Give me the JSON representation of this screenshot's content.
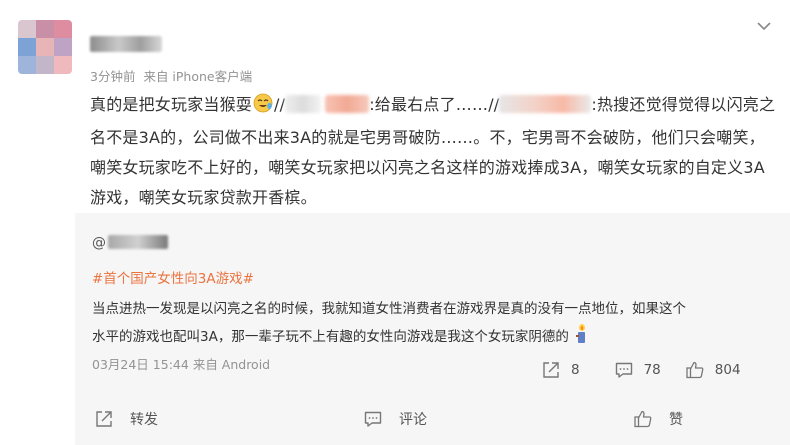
{
  "post": {
    "meta_time": "3分钟前",
    "meta_source": "来自 iPhone客户端",
    "text_a": "真的是把女玩家当猴耍",
    "text_b": "//",
    "text_c": ":给最右点了……//",
    "text_d": ":热搜还觉得觉得以闪亮之名不是3A的，公司做不出来3A的就是宅男哥破防……。不，宅男哥不会破防，他们只会嘲笑，嘲笑女玩家吃不上好的，嘲笑女玩家把以闪亮之名这样的游戏捧成3A，嘲笑女玩家的自定义3A游戏，嘲笑女玩家贷款开香槟。"
  },
  "repost": {
    "nick_prefix": "@",
    "tag": "#首个国产女性向3A游戏#",
    "text": "当点进热一发现是以闪亮之名的时候，我就知道女性消费者在游戏界是真的没有一点地位，如果这个水平的游戏也配叫3A，那一辈子玩不上有趣的女性向游戏是我这个女玩家阴德的",
    "date": "03月24日 15:44",
    "source": "来自 Android",
    "share_count": "8",
    "comment_count": "78",
    "like_count": "804"
  },
  "toolbar": {
    "repost_label": "转发",
    "comment_label": "评论",
    "like_label": "赞"
  },
  "icons": {
    "more": "chevron-down-icon",
    "share": "share-icon",
    "comment": "comment-icon",
    "like": "thumbs-up-icon",
    "emoji": "crying-laughing-emoji",
    "candle": "candle-emoji"
  },
  "colors": {
    "tag": "#eb7340",
    "meta": "#939393",
    "repost_bg": "#f6f6f6"
  }
}
